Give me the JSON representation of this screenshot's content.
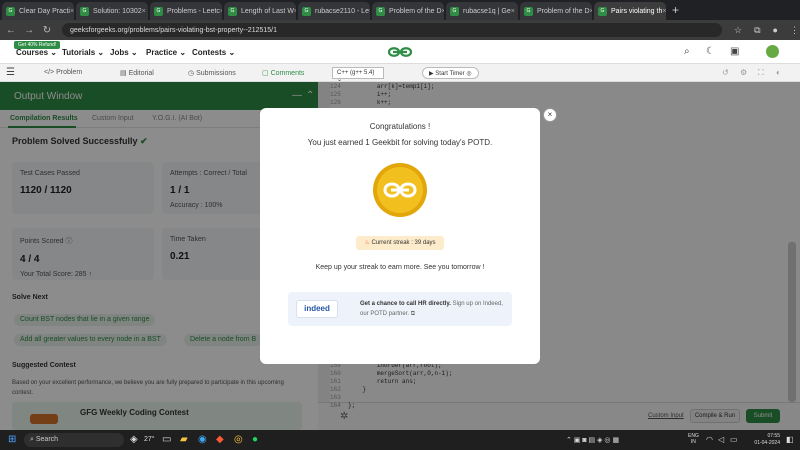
{
  "tabs": [
    {
      "label": "Clear Day Practi",
      "icon": "gfg"
    },
    {
      "label": "Solution: 10302",
      "icon": "gfg"
    },
    {
      "label": "Problems - Leetc",
      "icon": "gfg"
    },
    {
      "label": "Length of Last W",
      "icon": "gfg"
    },
    {
      "label": "rubacse2110 - Le",
      "icon": "gfg"
    },
    {
      "label": "Problem of the D",
      "icon": "gfg"
    },
    {
      "label": "rubacse1q | Ge",
      "icon": "gfg"
    },
    {
      "label": "Problem of the D",
      "icon": "gfg"
    },
    {
      "label": "Pairs violating th",
      "icon": "gfg",
      "active": true
    }
  ],
  "address": {
    "url": "geeksforgeeks.org/problems/pairs-violating-bst-property--212515/1"
  },
  "header": {
    "badge": "Get 40% Refund!",
    "menus": [
      "Courses",
      "Tutorials",
      "Jobs",
      "Practice",
      "Contests"
    ]
  },
  "toolbar": {
    "tabs": [
      "Problem",
      "Editorial",
      "Submissions",
      "Comments"
    ],
    "language": "C++ (g++ 5.4)",
    "timer": "Start Timer"
  },
  "output": {
    "title": "Output Window",
    "tabs": [
      "Compilation Results",
      "Custom Input",
      "Y.O.G.I. (AI Bot)"
    ],
    "status": "Problem Solved Successfully",
    "test_label": "Test Cases Passed",
    "test_value": "1120 / 1120",
    "attempts_label": "Attempts : Correct / Total",
    "attempts_value": "1 / 1",
    "accuracy": "Accuracy : 100%",
    "points_label": "Points Scored",
    "points_value": "4 / 4",
    "total_score": "Your Total Score: 285",
    "time_label": "Time Taken",
    "time_value": "0.21",
    "solve_next": "Solve Next",
    "next_items": [
      "Count BST nodes that lie in a given range",
      "Add all greater values to every node in a BST",
      "Delete a node from B"
    ],
    "suggested": "Suggested Contest",
    "suggested_text": "Based on your excellent performance, we believe you are fully prepared to participate in this upcoming contest.",
    "contest": "GFG Weekly Coding Contest"
  },
  "editor": {
    "top_lines": [
      {
        "n": "124",
        "code": "        arr[k]=temp1[i];"
      },
      {
        "n": "125",
        "code": "        i++;"
      },
      {
        "n": "126",
        "code": "        k++;"
      }
    ],
    "bottom_lines": [
      {
        "n": "159",
        "code": "        inorder(arr,root);"
      },
      {
        "n": "160",
        "code": "        mergeSort(arr,0,n-1);"
      },
      {
        "n": "161",
        "code": "        return ans;"
      },
      {
        "n": "162",
        "code": "    }"
      },
      {
        "n": "163",
        "code": ""
      },
      {
        "n": "164",
        "code": "};"
      }
    ],
    "custom_input": "Custom Input",
    "compile": "Compile & Run",
    "submit": "Submit"
  },
  "modal": {
    "congrats": "Congratulations !",
    "earned": "You just earned 1 Geekbit for solving today's POTD.",
    "streak": "Current streak : 39 days",
    "keep_up": "Keep up your streak to earn more. See you tomorrow !",
    "indeed_logo": "indeed",
    "promo_bold": "Get a chance to call HR directly.",
    "promo_text": "Sign up on Indeed, our POTD partner.",
    "close": "×"
  },
  "taskbar": {
    "search": "Search",
    "weather": "27°",
    "lang1": "ENG",
    "lang2": "IN",
    "time": "07:55",
    "date": "01-04-2024"
  },
  "colors": {
    "brand_green": "#2f8d46",
    "coin": "#f2c01e"
  }
}
